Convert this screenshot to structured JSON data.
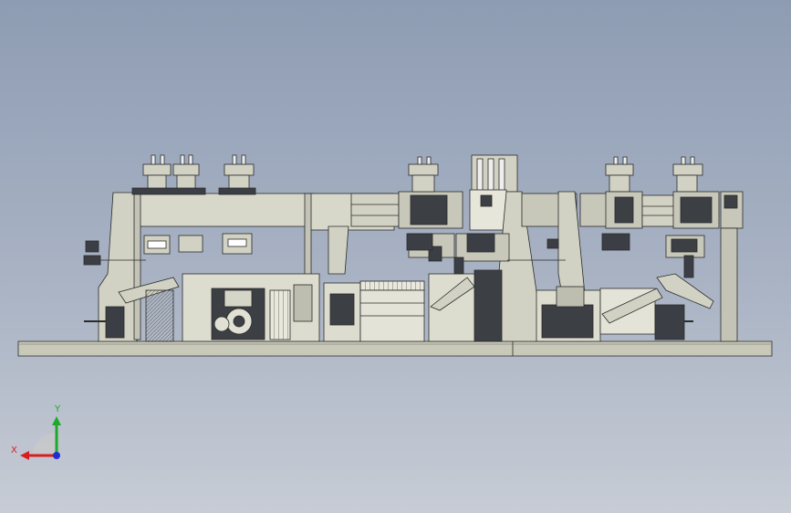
{
  "view": {
    "background_top": "#8e9cb3",
    "background_bottom": "#c7ccd5",
    "part_fill": "#d2d2c4",
    "part_stroke": "#2b2b2b",
    "dark_fill": "#4a4d52"
  },
  "triad": {
    "x_label": "X",
    "y_label": "Y",
    "x_color": "#d81f1f",
    "y_color": "#1fa82a",
    "z_color": "#1f2fd8"
  }
}
